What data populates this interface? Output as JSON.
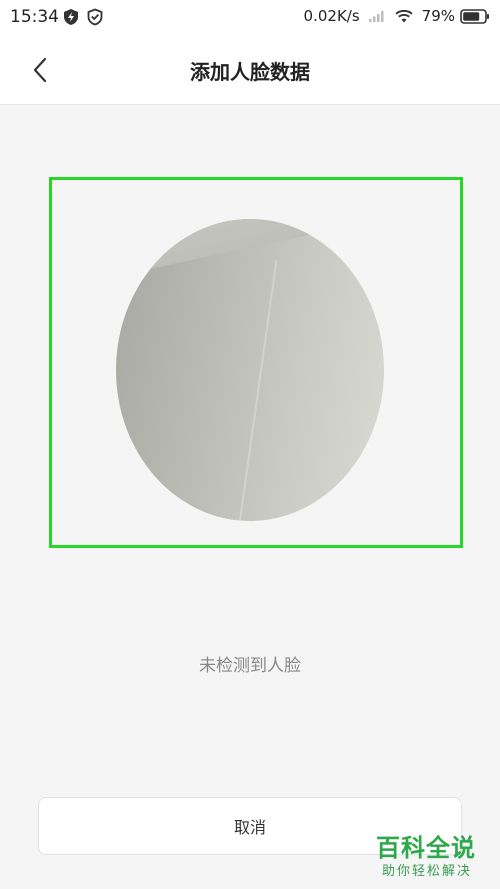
{
  "status_bar": {
    "time": "15:34",
    "network_speed": "0.02K/s",
    "battery_percent": "79%",
    "icons": [
      "lightning-shield-icon",
      "shield-check-icon",
      "signal-icon",
      "wifi-icon",
      "battery-icon"
    ]
  },
  "header": {
    "title": "添加人脸数据",
    "back_icon": "back-chevron-icon"
  },
  "camera": {
    "frame_color": "#27d627"
  },
  "detection": {
    "status_text": "未检测到人脸"
  },
  "actions": {
    "cancel_label": "取消"
  },
  "watermark": {
    "main": "百科全说",
    "sub": "助你轻松解决",
    "color": "#2da84a"
  }
}
